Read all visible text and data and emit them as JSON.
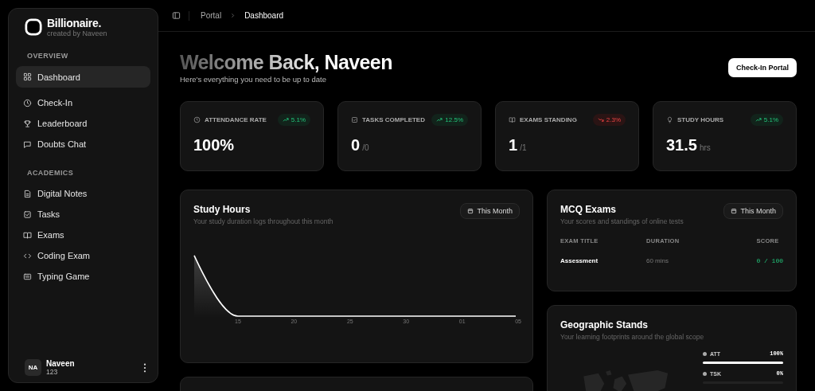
{
  "brand": {
    "name": "Billionaire.",
    "tagline": "created by Naveen"
  },
  "sidebar": {
    "sections": [
      {
        "heading": "OVERVIEW",
        "items": [
          {
            "label": "Dashboard",
            "selected": true
          },
          {
            "label": "Check-In",
            "selected": false
          },
          {
            "label": "Leaderboard",
            "selected": false
          },
          {
            "label": "Doubts Chat",
            "selected": false
          }
        ]
      },
      {
        "heading": "ACADEMICS",
        "items": [
          {
            "label": "Digital Notes",
            "selected": false
          },
          {
            "label": "Tasks",
            "selected": false
          },
          {
            "label": "Exams",
            "selected": false
          },
          {
            "label": "Coding Exam",
            "selected": false
          },
          {
            "label": "Typing Game",
            "selected": false
          }
        ]
      }
    ],
    "user": {
      "initials": "NA",
      "name": "Naveen",
      "id": "123"
    }
  },
  "breadcrumb": [
    "Portal",
    "Dashboard"
  ],
  "welcome": {
    "title": "Welcome Back, Naveen",
    "subtitle": "Here's everything you need to be up to date",
    "button": "Check-In Portal"
  },
  "stats": [
    {
      "label": "ATTENDANCE RATE",
      "kind": "up",
      "change": "5.1%",
      "value": "100%"
    },
    {
      "label": "TASKS COMPLETED",
      "kind": "up",
      "change": "12.5%",
      "value": "0",
      "unit": "/0"
    },
    {
      "label": "EXAMS STANDING",
      "kind": "down",
      "change": "2.3%",
      "value": "1",
      "unit": "/1"
    },
    {
      "label": "STUDY HOURS",
      "kind": "up",
      "change": "5.1%",
      "value": "31.5",
      "unit": "hrs"
    }
  ],
  "study_hours": {
    "title": "Study Hours",
    "subtitle": "Your study duration logs throughout this month",
    "filter": "This Month",
    "x_labels": [
      "15",
      "20",
      "25",
      "30",
      "01",
      "05"
    ]
  },
  "mcq_exams": {
    "title": "MCQ Exams",
    "subtitle": "Your scores and standings of online tests",
    "filter": "This Month",
    "columns": [
      "EXAM TITLE",
      "DURATION",
      "SCORE"
    ],
    "rows": [
      {
        "title": "Assessment",
        "duration": "60 mins",
        "score": "0 / 100"
      }
    ]
  },
  "geographic": {
    "title": "Geographic Stands",
    "subtitle": "Your learning footprints around the global scope",
    "metrics": [
      {
        "label": "ATT",
        "reading": "100%",
        "level": 1
      },
      {
        "label": "TSK",
        "reading": "0%",
        "level": 0
      }
    ]
  }
}
